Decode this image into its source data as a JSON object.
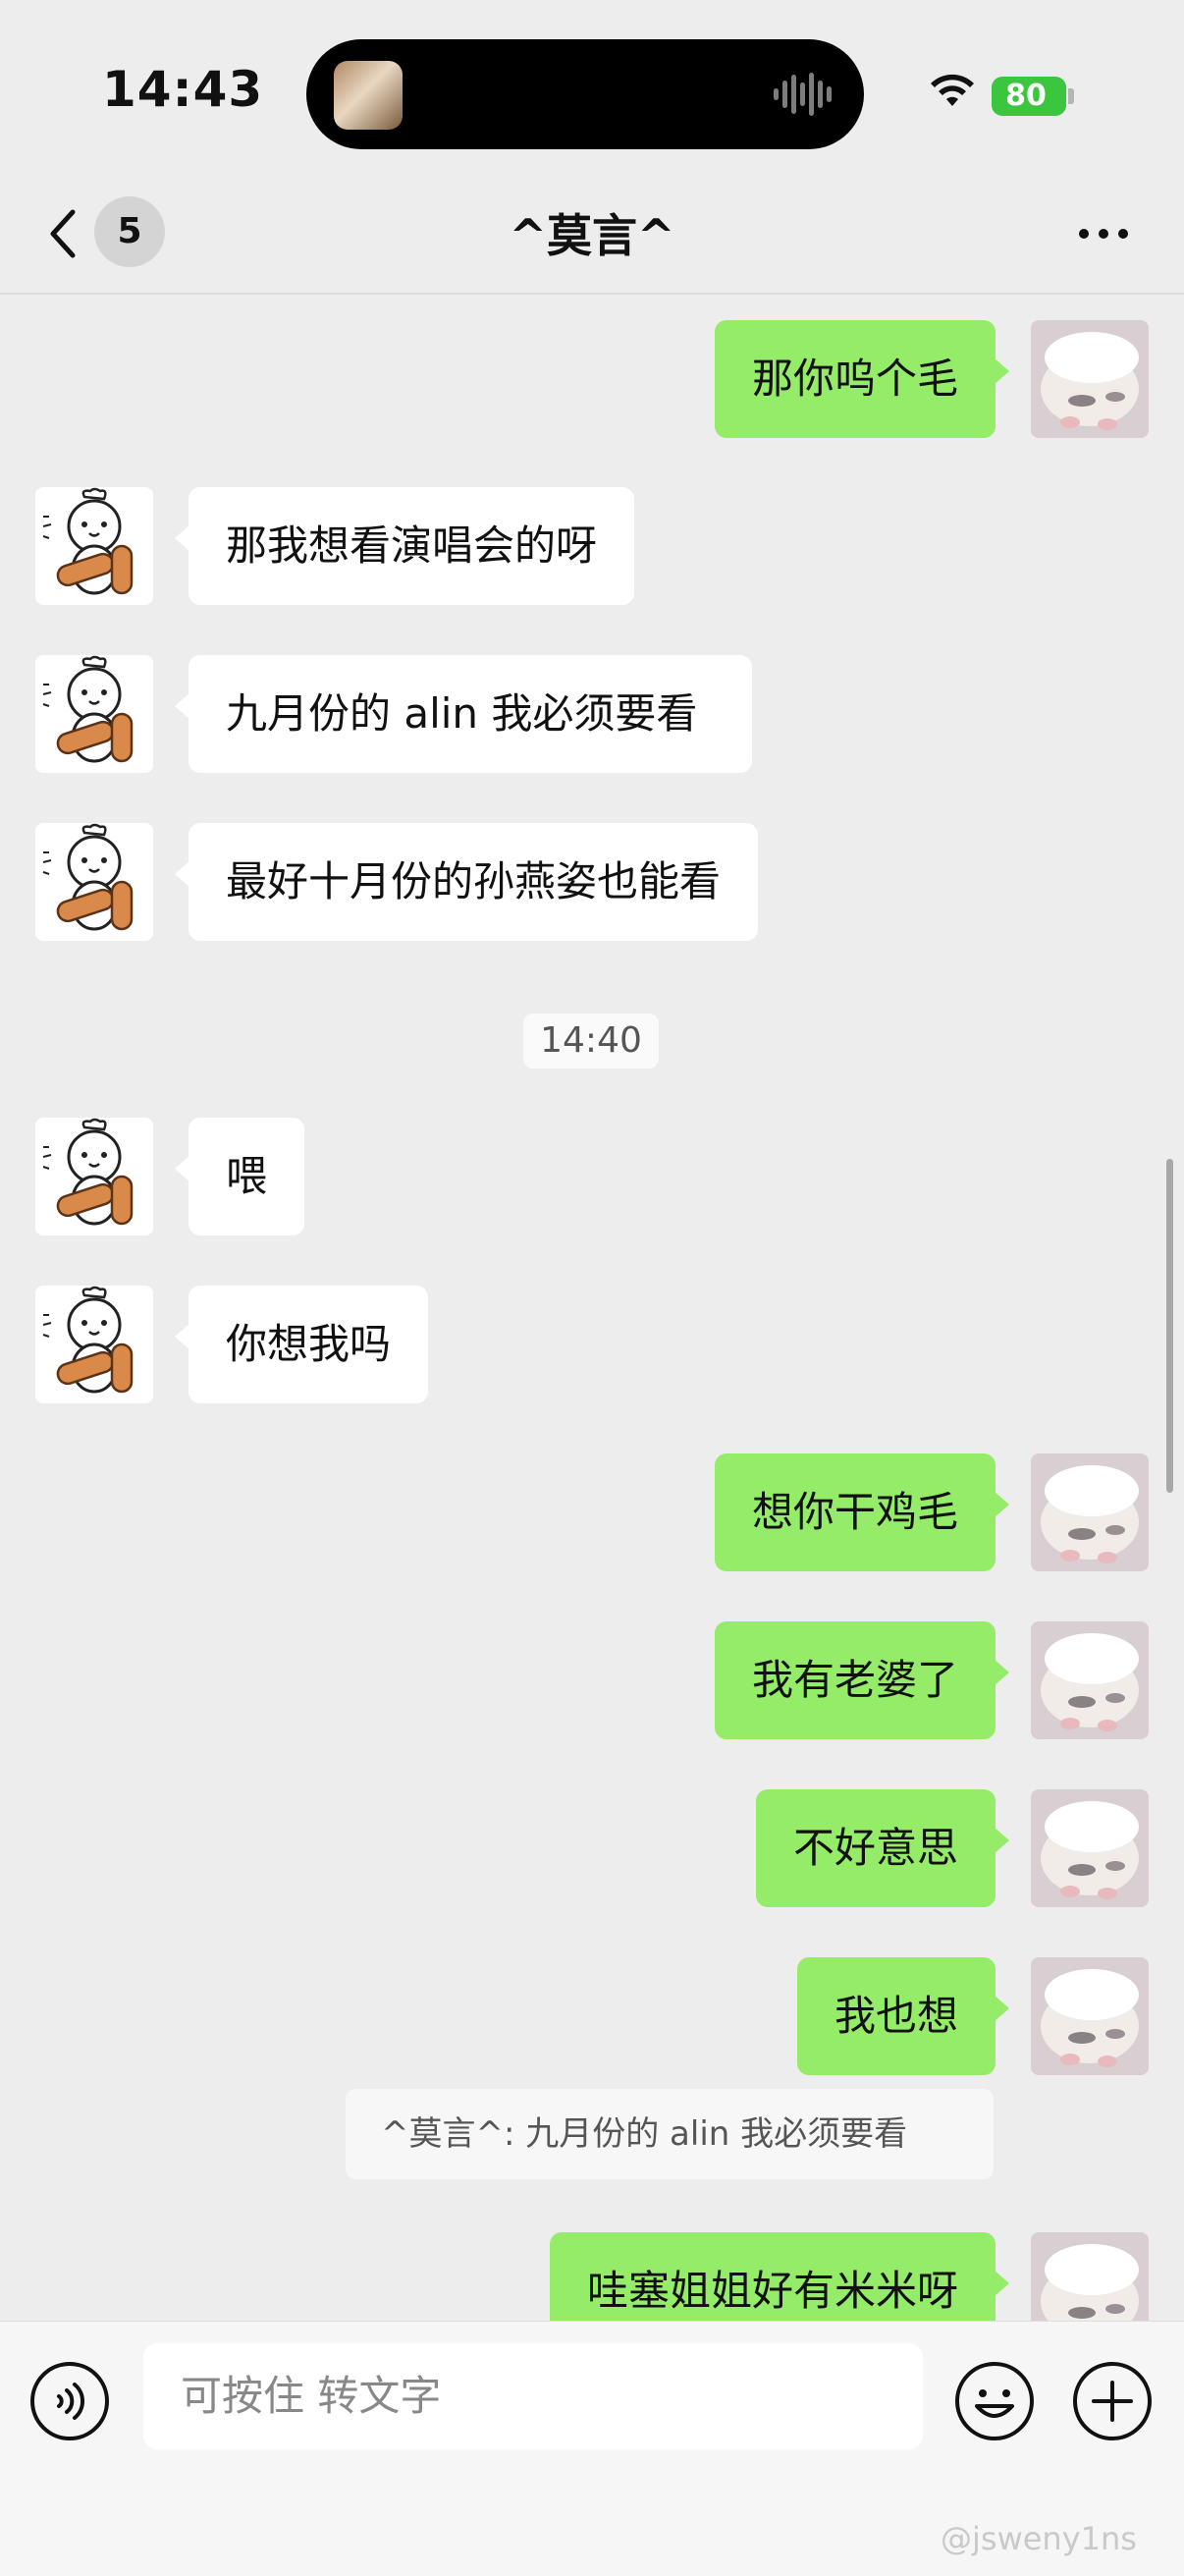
{
  "status_bar": {
    "time": "14:43",
    "battery": "80"
  },
  "header": {
    "unread_count": "5",
    "title": "^莫言^"
  },
  "messages": [
    {
      "side": "right",
      "text": "那你呜个毛"
    },
    {
      "side": "left",
      "text": "那我想看演唱会的呀"
    },
    {
      "side": "left",
      "text": "九月份的 alin 我必须要看"
    },
    {
      "side": "left",
      "text": "最好十月份的孙燕姿也能看"
    },
    {
      "timestamp": "14:40"
    },
    {
      "side": "left",
      "text": "喂"
    },
    {
      "side": "left",
      "text": "你想我吗"
    },
    {
      "side": "right",
      "text": "想你干鸡毛"
    },
    {
      "side": "right",
      "text": "我有老婆了"
    },
    {
      "side": "right",
      "text": "不好意思"
    },
    {
      "side": "right",
      "text": "我也想"
    },
    {
      "quote": "^莫言^: 九月份的 alin 我必须要看"
    },
    {
      "side": "right",
      "text": "哇塞姐姐好有米米呀"
    }
  ],
  "input": {
    "placeholder": "可按住 转文字"
  },
  "watermark": "@jsweny1ns",
  "colors": {
    "background": "#ededed",
    "self_bubble": "#95ec69",
    "other_bubble": "#ffffff",
    "battery": "#3cc640"
  },
  "icons": {
    "back": "chevron-left-icon",
    "more": "more-dots-icon",
    "voice": "voice-icon",
    "emoji": "emoji-icon",
    "plus": "plus-icon",
    "wifi": "wifi-icon"
  }
}
